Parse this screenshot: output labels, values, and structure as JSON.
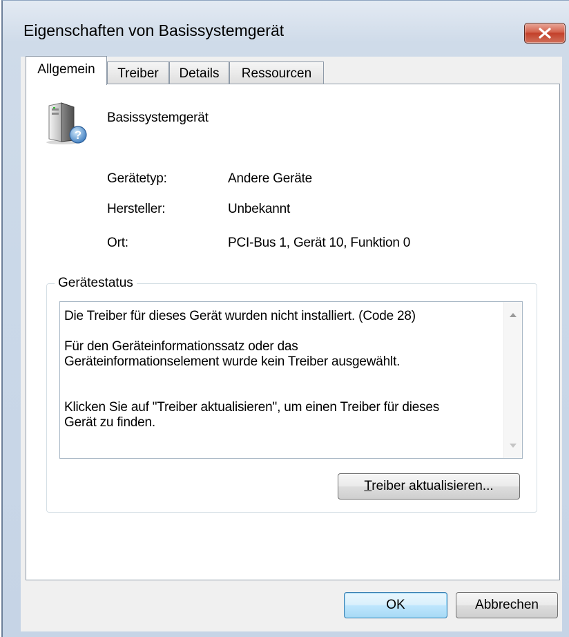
{
  "window": {
    "title": "Eigenschaften von Basissystemgerät"
  },
  "tabs": [
    {
      "label": "Allgemein",
      "active": true
    },
    {
      "label": "Treiber",
      "active": false
    },
    {
      "label": "Details",
      "active": false
    },
    {
      "label": "Ressourcen",
      "active": false
    }
  ],
  "device": {
    "name": "Basissystemgerät",
    "icon": "unknown-device-icon",
    "properties": [
      {
        "label": "Gerätetyp:",
        "value": "Andere Geräte"
      },
      {
        "label": "Hersteller:",
        "value": "Unbekannt"
      },
      {
        "label": "Ort:",
        "value": "PCI-Bus 1, Gerät 10, Funktion 0"
      }
    ]
  },
  "status": {
    "group_label": "Gerätestatus",
    "text": "Die Treiber für dieses Gerät wurden nicht installiert. (Code 28)\n\nFür den Geräteinformationssatz oder das\nGeräteinformationselement wurde kein Treiber ausgewählt.\n\n\nKlicken Sie auf \"Treiber aktualisieren\", um einen Treiber für dieses\nGerät zu finden.",
    "update_button": {
      "mnemonic": "T",
      "rest": "reiber aktualisieren..."
    }
  },
  "buttons": {
    "ok": "OK",
    "cancel": "Abbrechen"
  },
  "colors": {
    "titlebar": "#cfdbe9",
    "close_button": "#c3402a",
    "default_button_border": "#3c7fb1"
  }
}
